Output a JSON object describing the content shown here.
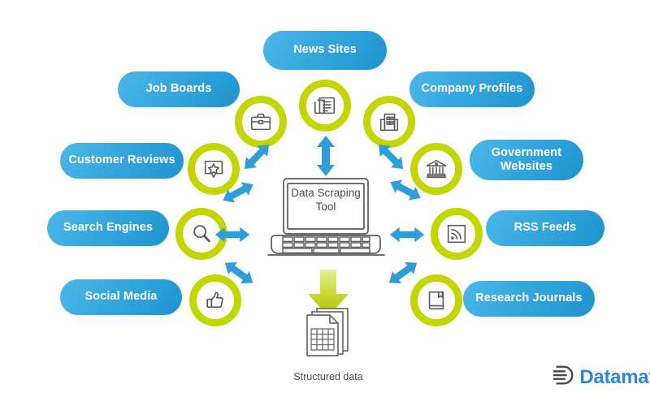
{
  "diagram": {
    "title": "Data Scraping Tool",
    "center": {
      "label_line1": "Data Scraping",
      "label_line2": "Tool",
      "icon": "laptop-icon"
    },
    "output": {
      "label": "Structured data",
      "icon": "documents-stack-icon",
      "arrow_icon": "down-arrow-icon"
    },
    "colors": {
      "pill_blue_light": "#4cb7e8",
      "pill_blue_dark": "#1f93cf",
      "ring_green": "#c3d600",
      "arrow_blue": "#2f9ed8",
      "arrow_green": "#c3d600",
      "outline_gray": "#5a5a5a",
      "text_gray": "#4a4a4a",
      "logo_blue": "#2f87d8"
    },
    "sources": [
      {
        "label": "News Sites",
        "icon": "newspaper-icon",
        "side": "top"
      },
      {
        "label": "Job Boards",
        "icon": "briefcase-icon",
        "side": "left"
      },
      {
        "label": "Company Profiles",
        "icon": "office-building-icon",
        "side": "right"
      },
      {
        "label": "Customer Reviews",
        "icon": "review-star-icon",
        "side": "left"
      },
      {
        "label": "Government Websites",
        "icon": "bank-icon",
        "side": "right"
      },
      {
        "label": "Search Engines",
        "icon": "magnifier-icon",
        "side": "left"
      },
      {
        "label": "RSS Feeds",
        "icon": "rss-icon",
        "side": "right"
      },
      {
        "label": "Social Media",
        "icon": "thumbs-up-icon",
        "side": "left"
      },
      {
        "label": "Research Journals",
        "icon": "book-icon",
        "side": "right"
      }
    ]
  },
  "branding": {
    "logo_mark": "datamatics-d-icon",
    "logo_text": "Datamat"
  }
}
